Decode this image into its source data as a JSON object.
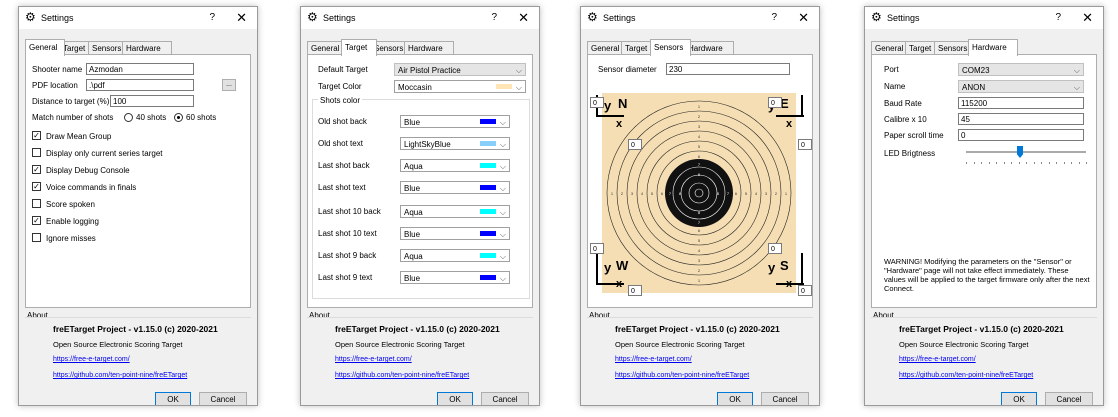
{
  "window": {
    "title": "Settings",
    "help": "?",
    "close": "✕"
  },
  "tabs": [
    "General",
    "Target",
    "Sensors",
    "Hardware"
  ],
  "general": {
    "shooter_name_label": "Shooter name",
    "shooter_name": "Azmodan",
    "pdf_location_label": "PDF location",
    "pdf_location": ".\\pdf",
    "browse_label": "...",
    "distance_label": "Distance to target (%)",
    "distance": "100",
    "match_shots_label": "Match number of shots",
    "shots_40": "40 shots",
    "shots_60": "60 shots",
    "selected_shots": "60 shots",
    "options": [
      {
        "label": "Draw Mean Group",
        "checked": true
      },
      {
        "label": "Display only current series target",
        "checked": false
      },
      {
        "label": "Display Debug Console",
        "checked": true
      },
      {
        "label": "Voice commands in finals",
        "checked": true
      },
      {
        "label": "Score spoken",
        "checked": false
      },
      {
        "label": "Enable logging",
        "checked": true
      },
      {
        "label": "Ignore misses",
        "checked": false
      }
    ]
  },
  "target": {
    "default_target_label": "Default Target",
    "default_target": "Air Pistol Practice",
    "target_color_label": "Target Color",
    "target_color": "Moccasin",
    "target_color_hex": "#ffe4b5",
    "shots_color_label": "Shots color",
    "rows": [
      {
        "label": "Old shot back",
        "value": "Blue",
        "hex": "#0000ff"
      },
      {
        "label": "Old shot text",
        "value": "LightSkyBlue",
        "hex": "#87cefa"
      },
      {
        "label": "Last shot back",
        "value": "Aqua",
        "hex": "#00ffff"
      },
      {
        "label": "Last shot text",
        "value": "Blue",
        "hex": "#0000ff"
      },
      {
        "label": "Last shot 10 back",
        "value": "Aqua",
        "hex": "#00ffff"
      },
      {
        "label": "Last shot 10 text",
        "value": "Blue",
        "hex": "#0000ff"
      },
      {
        "label": "Last shot 9 back",
        "value": "Aqua",
        "hex": "#00ffff"
      },
      {
        "label": "Last shot 9 text",
        "value": "Blue",
        "hex": "#0000ff"
      }
    ]
  },
  "sensors": {
    "diameter_label": "Sensor diameter",
    "diameter": "230",
    "fields": [
      "0",
      "0",
      "0",
      "0",
      "0",
      "0",
      "0",
      "0"
    ],
    "labels": {
      "y": "y",
      "x": "x",
      "n": "N",
      "e": "E",
      "w": "W",
      "s": "S"
    },
    "target_background": "#f5deb3",
    "ring_numbers": [
      "1",
      "2",
      "3",
      "4",
      "5",
      "6",
      "7",
      "8"
    ]
  },
  "hardware": {
    "port_label": "Port",
    "port": "COM23",
    "name_label": "Name",
    "name": "ANON",
    "baud_label": "Baud Rate",
    "baud": "115200",
    "calibre_label": "Calibre x 10",
    "calibre": "45",
    "paper_label": "Paper scroll time",
    "paper": "0",
    "led_label": "LED Brigtness",
    "led_level": 0.45,
    "warning": "WARNING! Modifying the parameters on the \"Sensor\" or \"Hardware\" page will not take effect immediately. These values will be applied to the target firmware only after the next Connect."
  },
  "about": {
    "title": "About",
    "name": "freETarget Project  -  v1.15.0  (c) 2020-2021",
    "desc": "Open Source Electronic Scoring Target",
    "link1": "https://free-e-target.com/",
    "link2": "https://github.com/ten-point-nine/freETarget"
  },
  "buttons": {
    "ok": "OK",
    "cancel": "Cancel"
  }
}
